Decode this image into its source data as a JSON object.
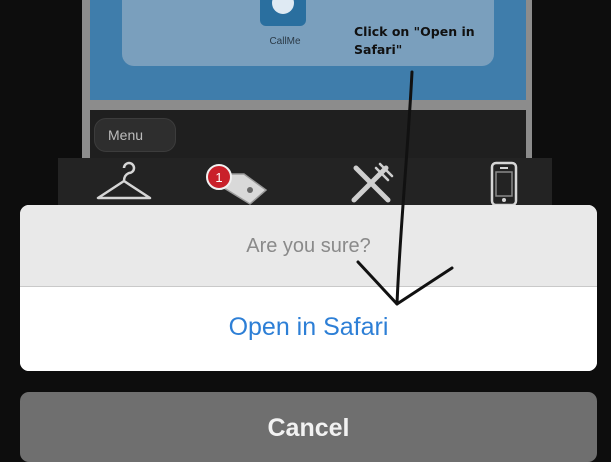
{
  "background_app": {
    "callme_label": "CallMe",
    "annotation": "Click on \"Open in\nSafari\"",
    "menu_label": "Menu",
    "notification_count": "1",
    "icons": [
      "hanger-icon",
      "tag-icon",
      "fork-knife-icon",
      "phone-icon"
    ]
  },
  "action_sheet": {
    "title": "Are you sure?",
    "action_label": "Open in Safari",
    "cancel_label": "Cancel"
  },
  "colors": {
    "action_blue": "#2d7fd6",
    "sheet_title_bg": "#e9e9e9",
    "cancel_bg": "#6f6f6f",
    "app_blue": "#3f7dab"
  }
}
